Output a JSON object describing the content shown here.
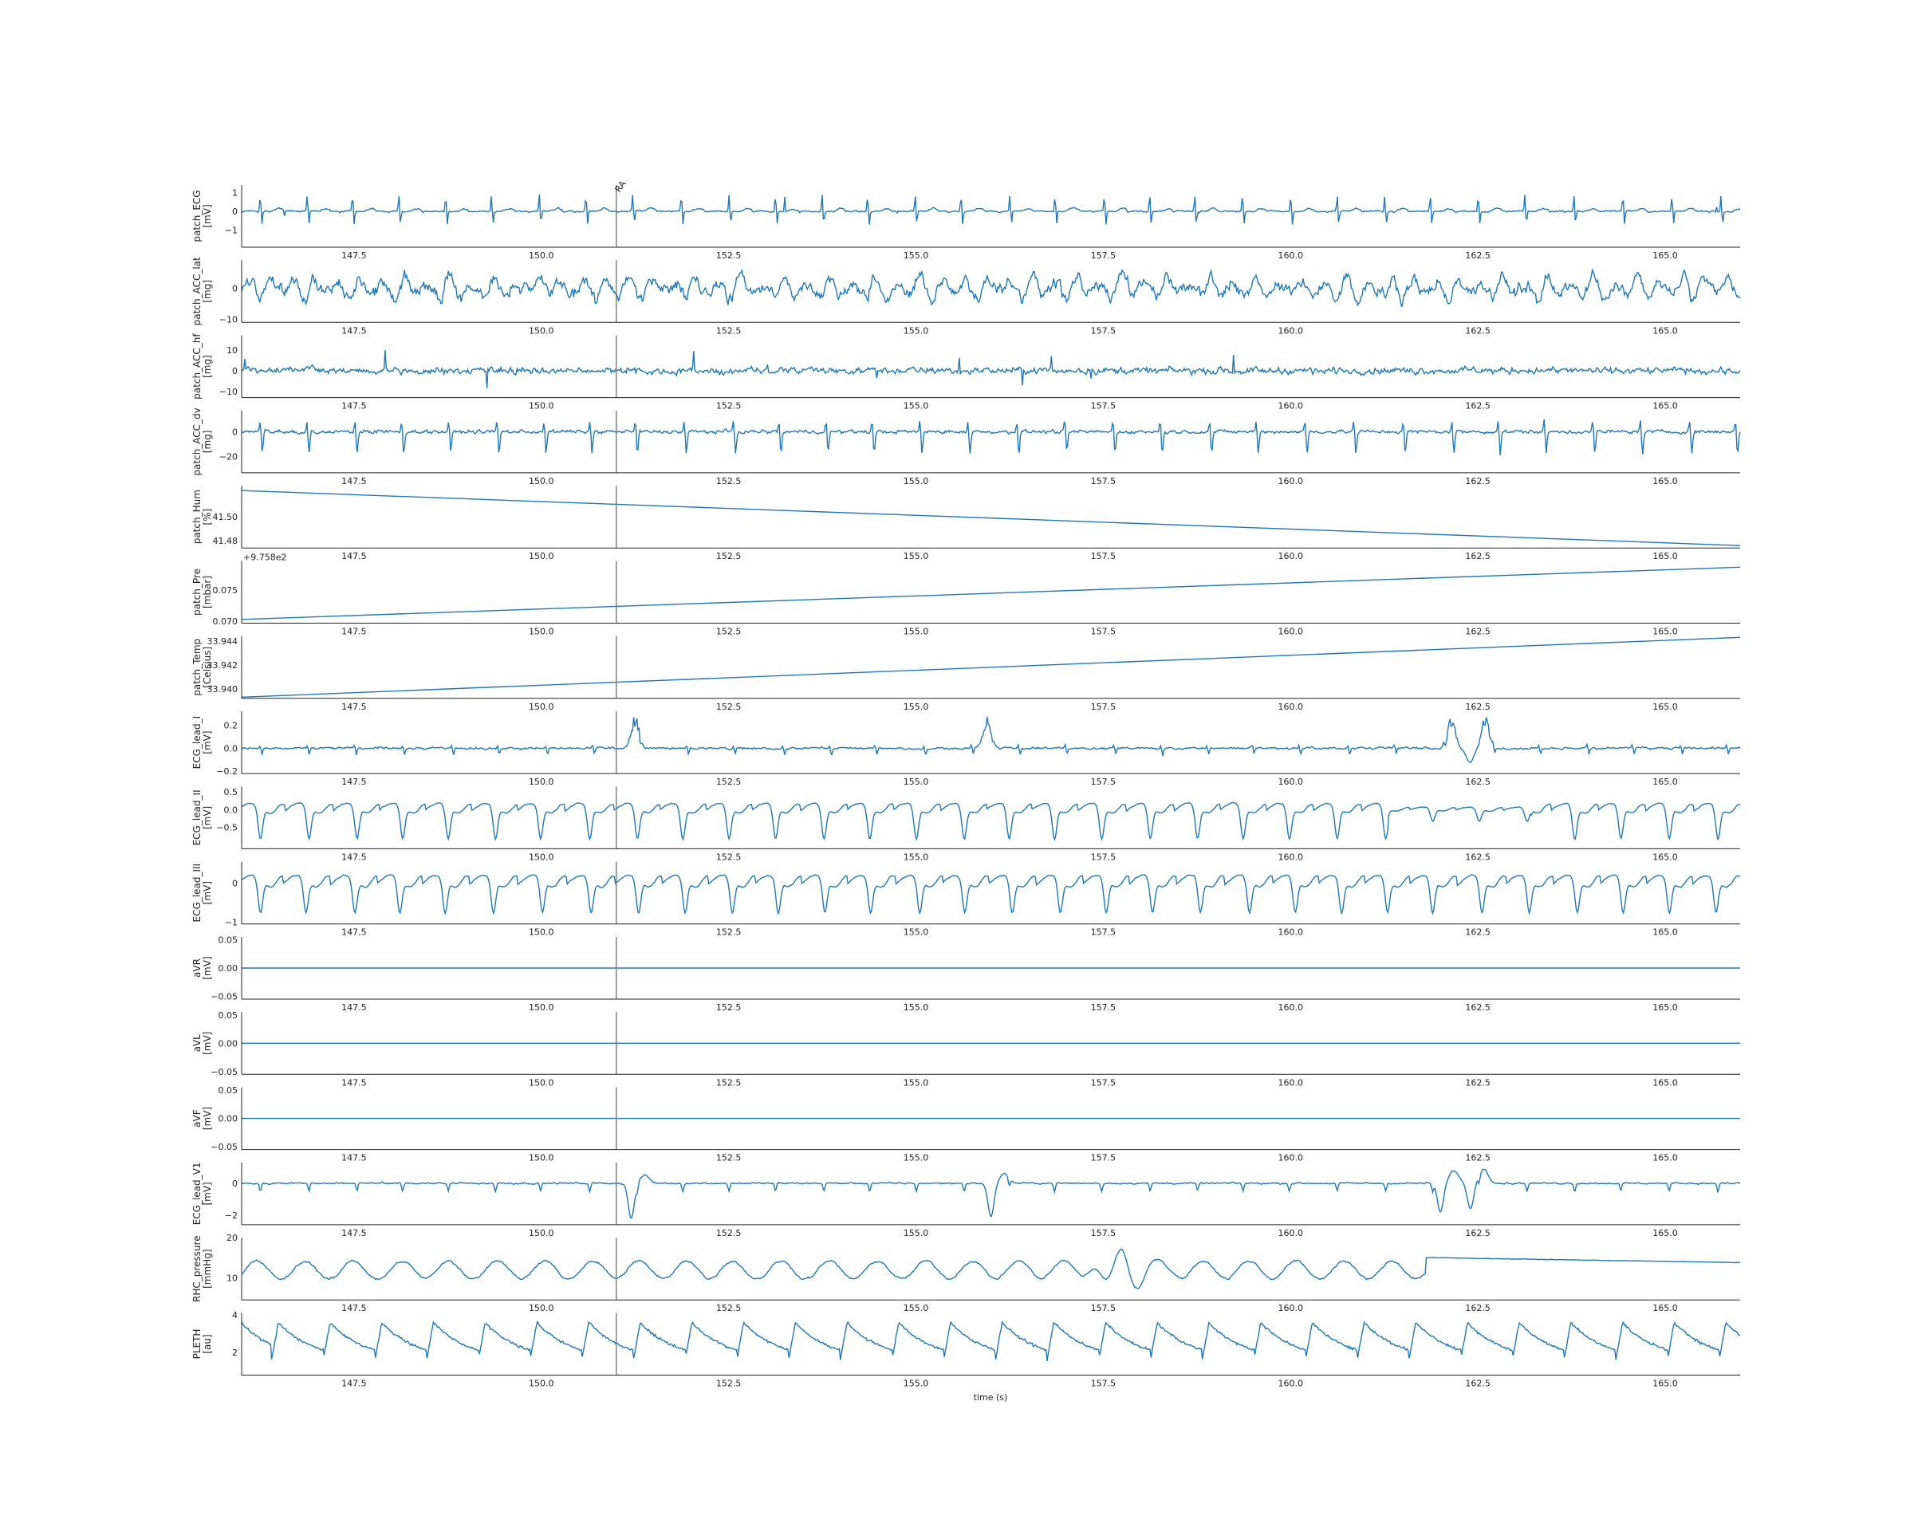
{
  "figure": {
    "xlabel": "time (s)",
    "x_range": [
      146.0,
      166.0
    ],
    "x_ticks": [
      147.5,
      150.0,
      152.5,
      155.0,
      157.5,
      160.0,
      162.5,
      165.0
    ],
    "x_tick_labels": [
      "147.5",
      "150.0",
      "152.5",
      "155.0",
      "157.5",
      "160.0",
      "162.5",
      "165.0"
    ],
    "event_marker": {
      "x": 151.0,
      "label": "RA"
    },
    "line_color": "#1f77b4",
    "marker_color": "#808080"
  },
  "chart_data": [
    {
      "type": "line",
      "ylabel": "patch_ECG\n[mV]",
      "yticks": [
        1,
        0,
        -1
      ],
      "ytick_labels": [
        "1",
        "0",
        "−1"
      ],
      "ylim": [
        -1.9,
        1.4
      ],
      "signal": "ecg_spiky",
      "annotation": "RA"
    },
    {
      "type": "line",
      "ylabel": "patch_ACC_lat\n[mg]",
      "yticks": [
        0,
        -10
      ],
      "ytick_labels": [
        "0",
        "−10"
      ],
      "ylim": [
        -11,
        9
      ],
      "signal": "noise"
    },
    {
      "type": "line",
      "ylabel": "patch_ACC_hf\n[mg]",
      "yticks": [
        10,
        0,
        -10
      ],
      "ytick_labels": [
        "10",
        "0",
        "−10"
      ],
      "ylim": [
        -13,
        17
      ],
      "signal": "noise_spiky"
    },
    {
      "type": "line",
      "ylabel": "patch_ACC_dv\n[mg]",
      "yticks": [
        0,
        -20
      ],
      "ytick_labels": [
        "0",
        "−20"
      ],
      "ylim": [
        -33,
        17
      ],
      "signal": "ecg_like_acc"
    },
    {
      "type": "line",
      "ylabel": "patch_Hum\n[%]",
      "yticks": [
        41.5,
        41.48
      ],
      "ytick_labels": [
        "41.50",
        "41.48"
      ],
      "ylim": [
        41.474,
        41.526
      ],
      "x": [
        146.0,
        166.0
      ],
      "y": [
        41.522,
        41.476
      ]
    },
    {
      "type": "line",
      "ylabel": "patch_Pre\n[mbar]",
      "yticks": [
        0.075,
        0.07
      ],
      "ytick_labels": [
        "0.075",
        "0.070"
      ],
      "ylim": [
        0.0697,
        0.0797
      ],
      "offset_label": "+9.758e2",
      "x": [
        146.0,
        166.0
      ],
      "y": [
        0.0703,
        0.0787
      ]
    },
    {
      "type": "line",
      "ylabel": "patch_Temp\n[Celsius]",
      "yticks": [
        33.944,
        33.942,
        33.94
      ],
      "ytick_labels": [
        "33.944",
        "33.942",
        "33.940"
      ],
      "ylim": [
        33.9392,
        33.9444
      ],
      "x": [
        146.0,
        166.0
      ],
      "y": [
        33.9393,
        33.9443
      ]
    },
    {
      "type": "line",
      "ylabel": "ECG_lead_I\n[mV]",
      "yticks": [
        0.2,
        0.0,
        -0.2
      ],
      "ytick_labels": [
        "0.2",
        "0.0",
        "−0.2"
      ],
      "ylim": [
        -0.22,
        0.32
      ],
      "signal": "lead_I"
    },
    {
      "type": "line",
      "ylabel": "ECG_lead_II\n[mV]",
      "yticks": [
        0.5,
        0.0,
        -0.5
      ],
      "ytick_labels": [
        "0.5",
        "0.0",
        "−0.5"
      ],
      "ylim": [
        -1.1,
        0.65
      ],
      "signal": "lead_II"
    },
    {
      "type": "line",
      "ylabel": "ECG_lead_III\n[mV]",
      "yticks": [
        0,
        -1
      ],
      "ytick_labels": [
        "0",
        "−1"
      ],
      "ylim": [
        -1.05,
        0.55
      ],
      "signal": "lead_III"
    },
    {
      "type": "line",
      "ylabel": "aVR\n[mV]",
      "yticks": [
        0.05,
        0.0,
        -0.05
      ],
      "ytick_labels": [
        "0.05",
        "0.00",
        "−0.05"
      ],
      "ylim": [
        -0.055,
        0.055
      ],
      "x": [
        146.0,
        166.0
      ],
      "y": [
        0.0,
        0.0
      ]
    },
    {
      "type": "line",
      "ylabel": "aVL\n[mV]",
      "yticks": [
        0.05,
        0.0,
        -0.05
      ],
      "ytick_labels": [
        "0.05",
        "0.00",
        "−0.05"
      ],
      "ylim": [
        -0.055,
        0.055
      ],
      "x": [
        146.0,
        166.0
      ],
      "y": [
        0.0,
        0.0
      ]
    },
    {
      "type": "line",
      "ylabel": "aVF\n[mV]",
      "yticks": [
        0.05,
        0.0,
        -0.05
      ],
      "ytick_labels": [
        "0.05",
        "0.00",
        "−0.05"
      ],
      "ylim": [
        -0.055,
        0.055
      ],
      "x": [
        146.0,
        166.0
      ],
      "y": [
        0.0,
        0.0
      ]
    },
    {
      "type": "line",
      "ylabel": "ECG_lead_V1\n[mV]",
      "yticks": [
        0,
        -2
      ],
      "ytick_labels": [
        "0",
        "−2"
      ],
      "ylim": [
        -2.6,
        1.3
      ],
      "signal": "lead_V1"
    },
    {
      "type": "line",
      "ylabel": "RHC_pressure\n[mmHg]",
      "yticks": [
        20,
        10
      ],
      "ytick_labels": [
        "20",
        "10"
      ],
      "ylim": [
        4.5,
        20
      ],
      "signal": "rhc"
    },
    {
      "type": "line",
      "ylabel": "PLETH\n[au]",
      "yticks": [
        4,
        2
      ],
      "ytick_labels": [
        "4",
        "2"
      ],
      "ylim": [
        0.8,
        4.1
      ],
      "signal": "pleth"
    }
  ]
}
